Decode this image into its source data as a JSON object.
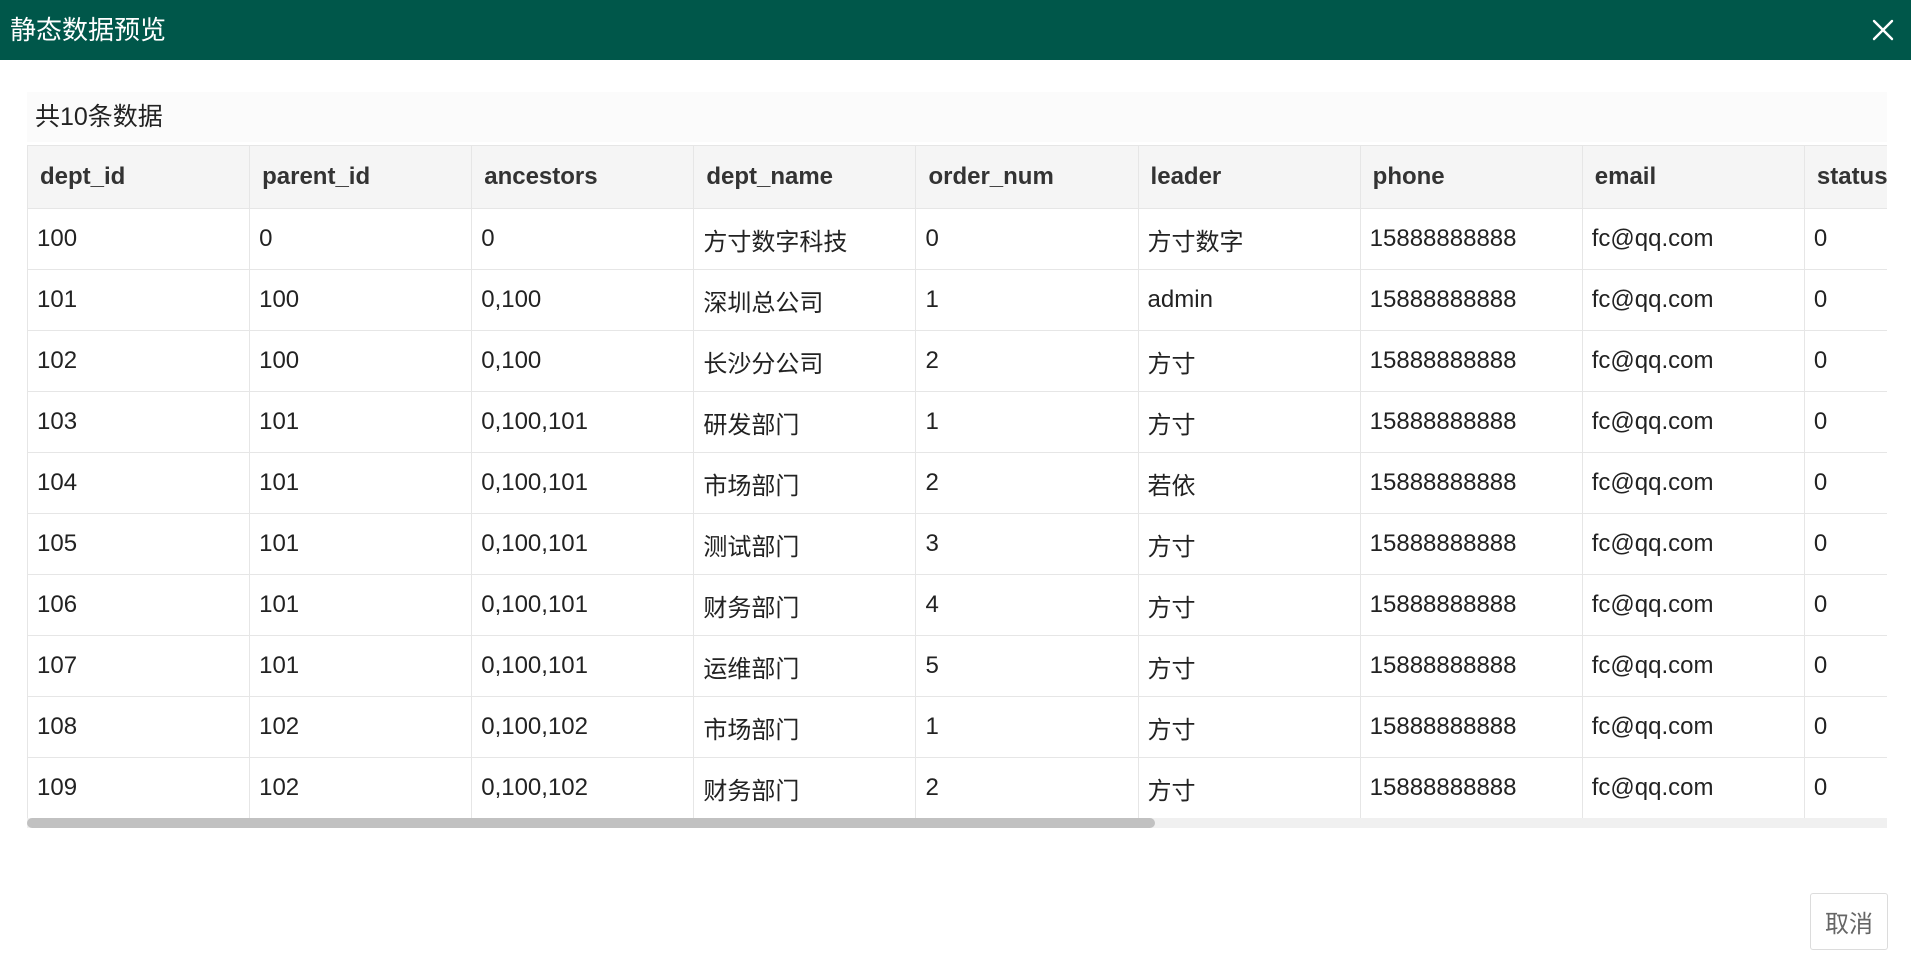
{
  "dialog": {
    "title": "静态数据预览",
    "close_icon": "close-icon"
  },
  "summary": {
    "count_text": "共10条数据"
  },
  "table": {
    "columns": [
      "dept_id",
      "parent_id",
      "ancestors",
      "dept_name",
      "order_num",
      "leader",
      "phone",
      "email",
      "status"
    ],
    "rows": [
      [
        "100",
        "0",
        "0",
        "方寸数字科技",
        "0",
        "方寸数字",
        "15888888888",
        "fc@qq.com",
        "0"
      ],
      [
        "101",
        "100",
        "0,100",
        "深圳总公司",
        "1",
        "admin",
        "15888888888",
        "fc@qq.com",
        "0"
      ],
      [
        "102",
        "100",
        "0,100",
        "长沙分公司",
        "2",
        "方寸",
        "15888888888",
        "fc@qq.com",
        "0"
      ],
      [
        "103",
        "101",
        "0,100,101",
        "研发部门",
        "1",
        "方寸",
        "15888888888",
        "fc@qq.com",
        "0"
      ],
      [
        "104",
        "101",
        "0,100,101",
        "市场部门",
        "2",
        "若依",
        "15888888888",
        "fc@qq.com",
        "0"
      ],
      [
        "105",
        "101",
        "0,100,101",
        "测试部门",
        "3",
        "方寸",
        "15888888888",
        "fc@qq.com",
        "0"
      ],
      [
        "106",
        "101",
        "0,100,101",
        "财务部门",
        "4",
        "方寸",
        "15888888888",
        "fc@qq.com",
        "0"
      ],
      [
        "107",
        "101",
        "0,100,101",
        "运维部门",
        "5",
        "方寸",
        "15888888888",
        "fc@qq.com",
        "0"
      ],
      [
        "108",
        "102",
        "0,100,102",
        "市场部门",
        "1",
        "方寸",
        "15888888888",
        "fc@qq.com",
        "0"
      ],
      [
        "109",
        "102",
        "0,100,102",
        "财务部门",
        "2",
        "方寸",
        "15888888888",
        "fc@qq.com",
        "0"
      ]
    ]
  },
  "footer": {
    "cancel_label": "取消"
  },
  "colors": {
    "header_bg": "#00574a",
    "header_text": "#ffffff",
    "table_header_bg": "#f5f5f5",
    "border": "#e6e6e6"
  }
}
